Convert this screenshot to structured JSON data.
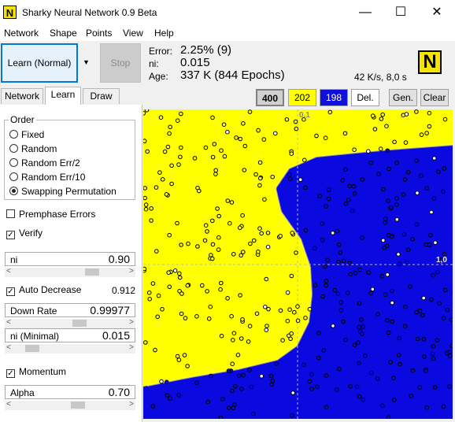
{
  "window": {
    "title": "Sharky Neural Network 0.9 Beta",
    "icon_letter": "N",
    "minimize_glyph": "—",
    "maximize_glyph": "☐",
    "close_glyph": "✕"
  },
  "menu": [
    "Network",
    "Shape",
    "Points",
    "View",
    "Help"
  ],
  "toolbar": {
    "learn_label": "Learn (Normal)",
    "dropdown_glyph": "▼",
    "stop_label": "Stop",
    "error_label": "Error:",
    "error_value": "2.25% (9)",
    "ni_label": "ni:",
    "ni_value": "0.015",
    "age_label": "Age:",
    "age_value": "337 K (844 Epochs)",
    "speed": "42 K/s, 8,0 s",
    "logo_letter": "N"
  },
  "tabs": [
    "Network",
    "Learn",
    "Draw"
  ],
  "learn": {
    "order_title": "Order",
    "order_options": [
      "Fixed",
      "Random",
      "Random Err/2",
      "Random Err/10",
      "Swapping Permutation"
    ],
    "order_selected": 4,
    "premphase_label": "Premphase Errors",
    "premphase_checked": false,
    "verify_label": "Verify",
    "verify_checked": true,
    "ni_label": "ni",
    "ni_value": "0.90",
    "ni_slider": 0.73,
    "auto_decrease_label": "Auto Decrease",
    "auto_decrease_checked": true,
    "auto_decrease_value": "0.912",
    "down_rate_label": "Down Rate",
    "down_rate_value": "0.99977",
    "down_rate_slider": 0.6,
    "ni_min_label": "ni (Minimal)",
    "ni_min_value": "0.015",
    "ni_min_slider": 0.1,
    "momentum_label": "Momentum",
    "momentum_checked": true,
    "alpha_label": "Alpha",
    "alpha_value": "0.70",
    "alpha_slider": 0.58
  },
  "canvas": {
    "count_total": "400",
    "count_yellow": "202",
    "count_blue": "198",
    "del_label": "Del.",
    "gen_label": "Gen.",
    "clear_label": "Clear",
    "axis_top_label": "0,1",
    "axis_right_label": "1,0",
    "yellow_color": "#ffff00",
    "blue_color": "#0a0ae0"
  }
}
